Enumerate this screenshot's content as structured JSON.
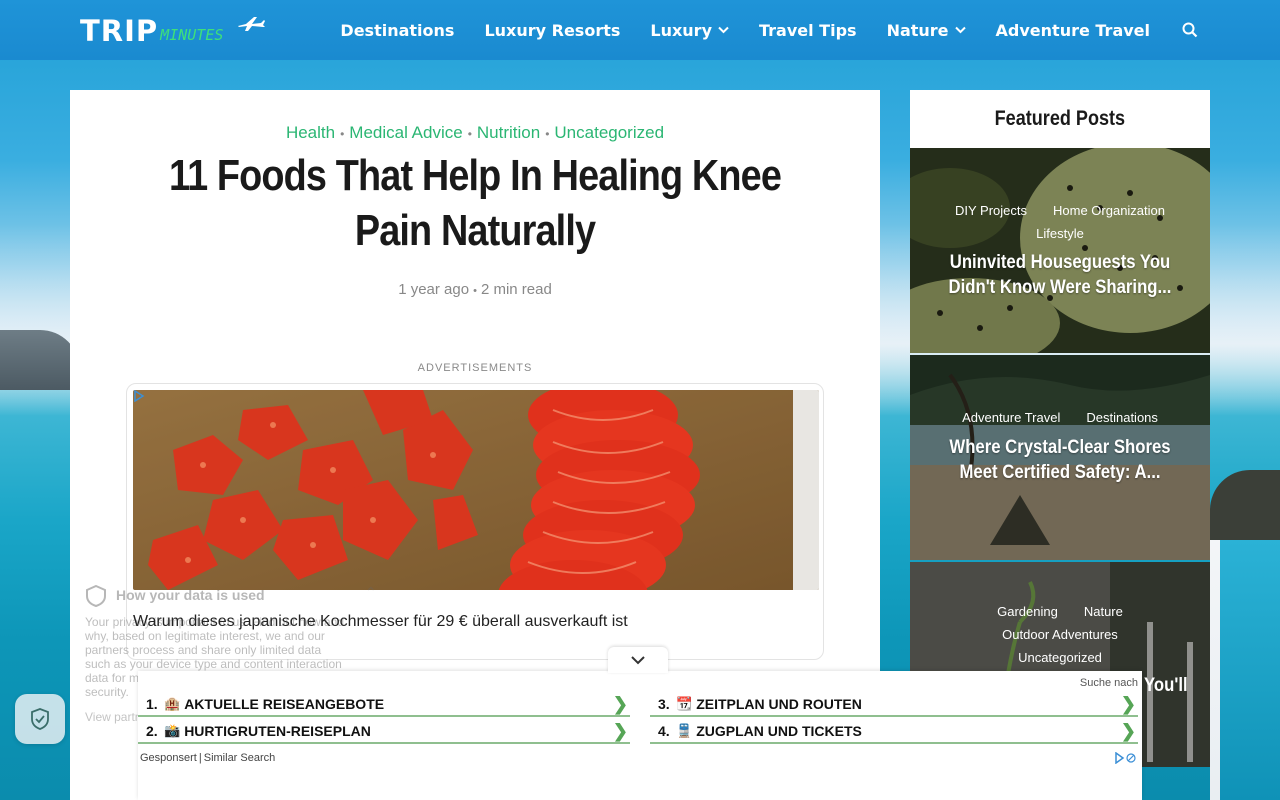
{
  "header": {
    "logo_main": "TRIP",
    "logo_sub": "MINUTES",
    "nav": [
      {
        "label": "Destinations",
        "dropdown": false
      },
      {
        "label": "Luxury Resorts",
        "dropdown": false
      },
      {
        "label": "Luxury",
        "dropdown": true
      },
      {
        "label": "Travel Tips",
        "dropdown": false
      },
      {
        "label": "Nature",
        "dropdown": true
      },
      {
        "label": "Adventure Travel",
        "dropdown": false
      }
    ],
    "search_icon": "search-icon"
  },
  "article": {
    "categories": [
      "Health",
      "Medical Advice",
      "Nutrition",
      "Uncategorized"
    ],
    "title": "11 Foods That Help In Healing Knee Pain Naturally",
    "age": "1 year ago",
    "read_time": "2 min read",
    "ad_label": "ADVERTISEMENTS",
    "ad_text": "Warum dieses japanische Kochmesser für 29 € überall ausverkauft ist"
  },
  "privacy": {
    "title": "How your data is used",
    "body": "Your privacy is important to us. Find out how and why, based on legitimate interest, we and our partners process and share only limited data such as your device type and content interaction data for measurement, product development and security.",
    "link": "View partners"
  },
  "sidebar": {
    "title": "Featured Posts",
    "posts": [
      {
        "categories": [
          "DIY Projects",
          "Home Organization",
          "Lifestyle"
        ],
        "title": "Uninvited Houseguests You Didn't Know Were Sharing..."
      },
      {
        "categories": [
          "Adventure Travel",
          "Destinations"
        ],
        "title": "Where Crystal-Clear Shores Meet Certified Safety: A..."
      },
      {
        "categories": [
          "Gardening",
          "Nature",
          "Outdoor Adventures",
          "Uncategorized"
        ],
        "title": "You'll"
      }
    ]
  },
  "search_ad": {
    "label": "Suche nach",
    "items": [
      {
        "num": "1.",
        "emoji": "🏨",
        "text": "AKTUELLE REISEANGEBOTE"
      },
      {
        "num": "2.",
        "emoji": "📸",
        "text": "HURTIGRUTEN-REISEPLAN"
      },
      {
        "num": "3.",
        "emoji": "📆",
        "text": "ZEITPLAN UND ROUTEN"
      },
      {
        "num": "4.",
        "emoji": "🚆",
        "text": "ZUGPLAN UND TICKETS"
      }
    ],
    "sponsored": "Gesponsert",
    "similar": "Similar Search"
  },
  "colors": {
    "header": "#1b8fd4",
    "category": "#2bb673",
    "logo_accent": "#3ee07a",
    "ad_arrow": "#56a556"
  }
}
